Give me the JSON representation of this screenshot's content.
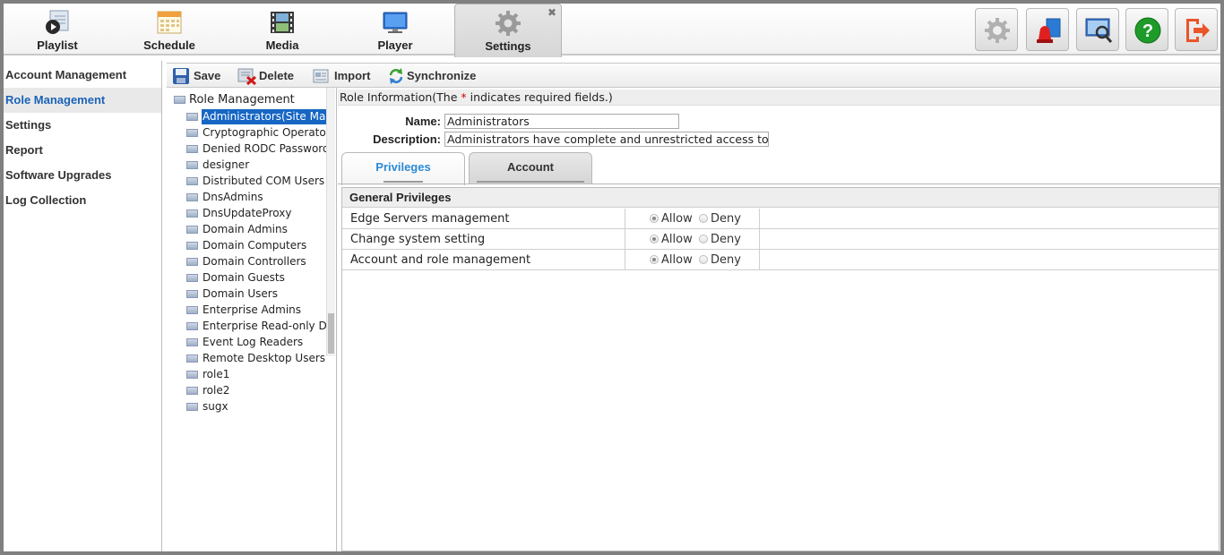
{
  "nav": {
    "tabs": [
      {
        "label": "Playlist",
        "icon": "playlist-icon"
      },
      {
        "label": "Schedule",
        "icon": "schedule-icon"
      },
      {
        "label": "Media",
        "icon": "media-icon"
      },
      {
        "label": "Player",
        "icon": "player-icon"
      },
      {
        "label": "Settings",
        "icon": "settings-icon",
        "active": true
      }
    ],
    "close_glyph": "✖",
    "tools": [
      "gear-icon",
      "alarm-icon",
      "monitor-search-icon",
      "help-icon",
      "logout-icon"
    ]
  },
  "sidebar": {
    "items": [
      {
        "label": "Account Management"
      },
      {
        "label": "Role Management",
        "active": true
      },
      {
        "label": "Settings"
      },
      {
        "label": "Report"
      },
      {
        "label": "Software Upgrades"
      },
      {
        "label": "Log Collection"
      }
    ]
  },
  "toolbar": {
    "save_label": "Save",
    "delete_label": "Delete",
    "import_label": "Import",
    "sync_label": "Synchronize"
  },
  "tree": {
    "root": "Role Management",
    "nodes": [
      "Administrators(Site Management)",
      "Cryptographic Operators",
      "Denied RODC Password",
      "designer",
      "Distributed COM Users",
      "DnsAdmins",
      "DnsUpdateProxy",
      "Domain Admins",
      "Domain Computers",
      "Domain Controllers",
      "Domain Guests",
      "Domain Users",
      "Enterprise Admins",
      "Enterprise Read-only Domain",
      "Event Log Readers",
      "Remote Desktop Users",
      "role1",
      "role2",
      "sugx"
    ],
    "selected": 0
  },
  "role_info": {
    "header_prefix": "Role Information(The ",
    "header_star": "*",
    "header_suffix": " indicates required fields.)",
    "name_label": "Name:",
    "name_value": "Administrators",
    "desc_label": "Description:",
    "desc_value": "Administrators have complete and unrestricted access to"
  },
  "subtabs": {
    "privileges": "Privileges",
    "account": "Account"
  },
  "privileges": {
    "section_title": "General Privileges",
    "allow_label": "Allow",
    "deny_label": "Deny",
    "rows": [
      {
        "name": "Edge Servers management",
        "value": "Allow"
      },
      {
        "name": "Change system setting",
        "value": "Allow"
      },
      {
        "name": "Account and role management",
        "value": "Allow"
      }
    ]
  }
}
